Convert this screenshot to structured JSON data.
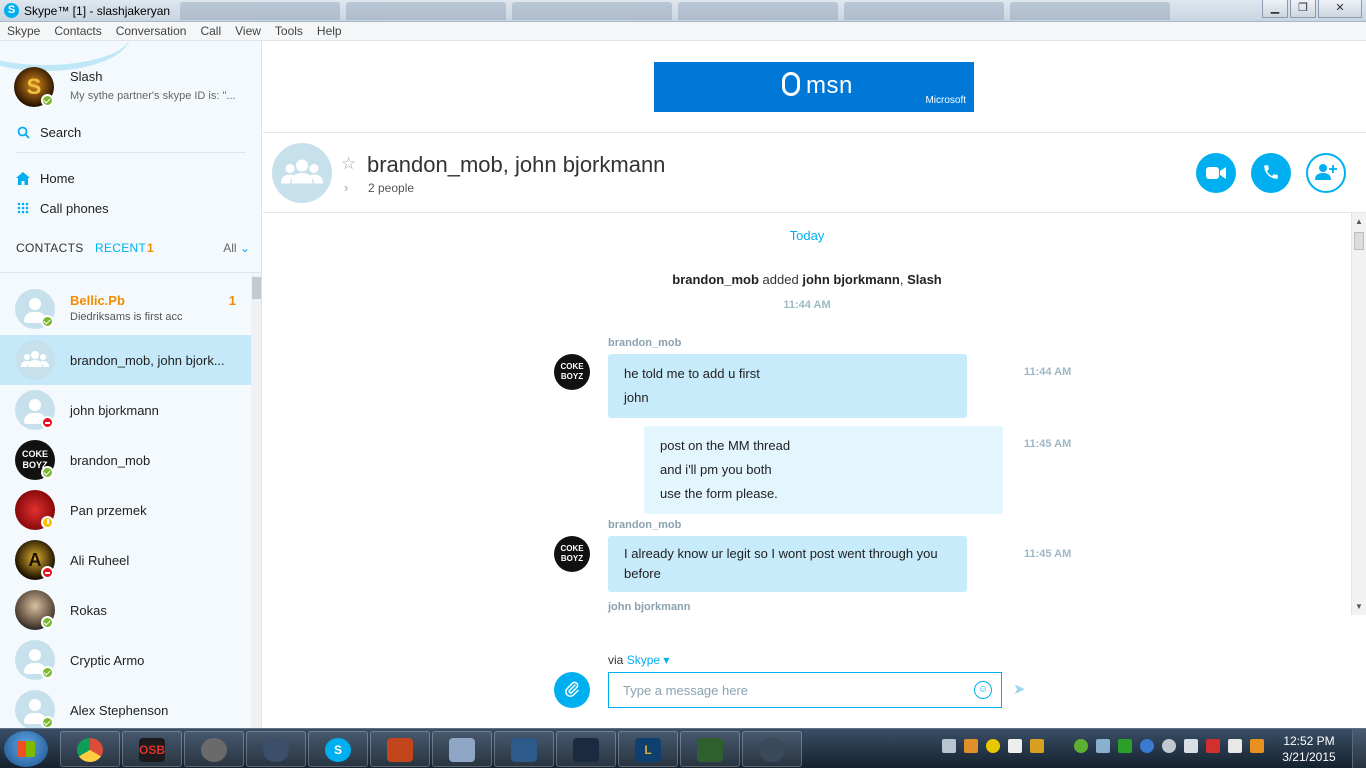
{
  "window": {
    "title": "Skype™ [1] - slashjakeryan",
    "minimize": "▁",
    "maximize": "❐",
    "close": "✕"
  },
  "menu": [
    "Skype",
    "Contacts",
    "Conversation",
    "Call",
    "View",
    "Tools",
    "Help"
  ],
  "profile": {
    "name": "Slash",
    "mood": "My sythe partner's skype ID is: \"...",
    "status": "online"
  },
  "sidebar": {
    "search_label": "Search",
    "home_label": "Home",
    "call_phones_label": "Call phones",
    "tab_contacts": "CONTACTS",
    "tab_recent": "RECENT",
    "recent_badge": "1",
    "filter_label": "All",
    "icons": {
      "search": "search-icon",
      "home": "home-icon",
      "dialpad": "dialpad-icon",
      "filter_chevron": "chevron-down-icon"
    }
  },
  "contacts": [
    {
      "name": "Bellic.Pb",
      "sub": "Diedriksams is first acc",
      "count": "1",
      "status": "online",
      "avatar": "default"
    },
    {
      "name": "brandon_mob, john bjork...",
      "status": "",
      "avatar": "group",
      "selected": true
    },
    {
      "name": "john bjorkmann",
      "status": "busy",
      "avatar": "default"
    },
    {
      "name": "brandon_mob",
      "status": "online",
      "avatar": "photo",
      "color": "#111111"
    },
    {
      "name": "Pan przemek",
      "status": "away",
      "avatar": "photo",
      "color": "#a11212"
    },
    {
      "name": "Ali Ruheel",
      "status": "busy",
      "avatar": "photo",
      "color": "#3a2a0a"
    },
    {
      "name": "Rokas",
      "status": "online",
      "avatar": "photo",
      "color": "#4a3a2a"
    },
    {
      "name": "Cryptic Armo",
      "status": "online",
      "avatar": "default"
    },
    {
      "name": "Alex Stephenson",
      "status": "online",
      "avatar": "default"
    }
  ],
  "ad": {
    "brand": "msn",
    "maker": "Microsoft"
  },
  "conversation": {
    "title": "brandon_mob, john bjorkmann",
    "people": "2 people",
    "icons": {
      "favorite": "star-icon",
      "video": "video-call-icon",
      "call": "phone-call-icon",
      "add": "add-people-icon",
      "expand": "chevron-right-icon"
    }
  },
  "messages": {
    "day": "Today",
    "system": {
      "actor": "brandon_mob",
      "verb": "added",
      "target1": "john bjorkmann",
      "target2": "Slash",
      "time": "11:44 AM"
    },
    "sender1": "brandon_mob",
    "b1_l1": "he told me to add u first",
    "b1_l2": "john",
    "b1_time": "11:44 AM",
    "b2_l1": "post on the MM thread",
    "b2_l2": "and i'll pm you both",
    "b2_l3": "use the form please.",
    "b2_time": "11:45 AM",
    "sender2": "brandon_mob",
    "b3_text": "I already know ur legit so I wont post went through you before",
    "b3_time": "11:45 AM",
    "sender3": "john bjorkmann"
  },
  "compose": {
    "via_label": "via",
    "via_service": "Skype",
    "placeholder": "Type a message here",
    "icons": {
      "attach": "attach-icon",
      "emoji": "emoji-icon",
      "send": "send-icon"
    }
  },
  "taskbar": {
    "apps": [
      {
        "name": "chrome",
        "label": "",
        "color": "#dd4b39"
      },
      {
        "name": "osbuddy",
        "label": "OSB",
        "color": "#1c1c1c"
      },
      {
        "name": "app3",
        "label": "",
        "color": "#6a6a6a"
      },
      {
        "name": "app4",
        "label": "",
        "color": "#3b4f6a"
      },
      {
        "name": "skype",
        "label": "S",
        "color": "#00aff0"
      },
      {
        "name": "app6",
        "label": "",
        "color": "#c2451c"
      },
      {
        "name": "calculator",
        "label": "",
        "color": "#8fa7c4"
      },
      {
        "name": "app8",
        "label": "",
        "color": "#2c5a8a"
      },
      {
        "name": "app9",
        "label": "",
        "color": "#1a2a40"
      },
      {
        "name": "league",
        "label": "L",
        "color": "#0e3f6e"
      },
      {
        "name": "app11",
        "label": "",
        "color": "#2f5f2f"
      },
      {
        "name": "app12",
        "label": "",
        "color": "#3a4a5a"
      }
    ],
    "time": "12:52 PM",
    "date": "3/21/2015"
  }
}
